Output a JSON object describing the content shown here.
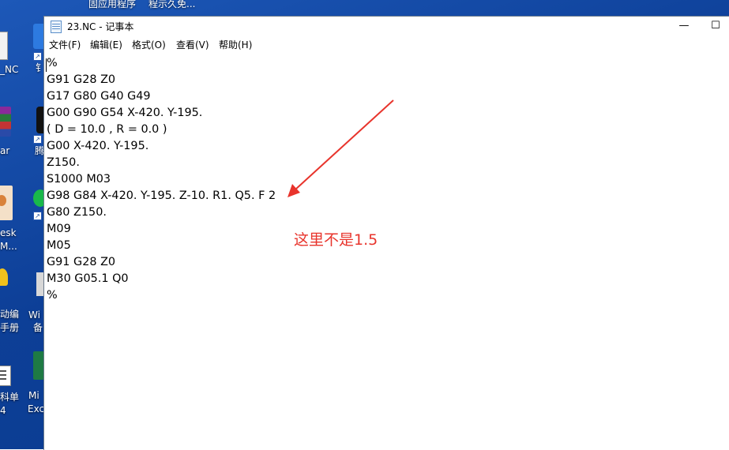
{
  "desktop": {
    "top_labels": [
      "固应用程序",
      "程示久免..."
    ],
    "icons": [
      {
        "label": "_NC"
      },
      {
        "label": "ar"
      },
      {
        "label": "esk"
      },
      {
        "label": "M..."
      },
      {
        "label": "动编"
      },
      {
        "label": "手册"
      },
      {
        "label": "科单"
      },
      {
        "label": "4"
      }
    ],
    "partial_labels": [
      "钅",
      "腾",
      "Wi",
      "备",
      "Mi",
      "Exc"
    ]
  },
  "window": {
    "title": "23.NC - 记事本",
    "minimize_glyph": "—",
    "maximize_glyph": "☐"
  },
  "menu": {
    "file": "文件(F)",
    "edit": "编辑(E)",
    "format": "格式(O)",
    "view": "查看(V)",
    "help": "帮助(H)"
  },
  "editor": {
    "lines": [
      "%",
      "G91 G28 Z0",
      "G17 G80 G40 G49",
      "G00 G90 G54 X-420. Y-195.",
      "( D = 10.0 , R = 0.0 )",
      "G00 X-420. Y-195.",
      "Z150.",
      "S1000 M03",
      "G98 G84 X-420. Y-195. Z-10. R1. Q5. F 2",
      "G80 Z150.",
      "M09",
      "M05",
      "G91 G28 Z0",
      "M30 G05.1 Q0",
      "%"
    ]
  },
  "annotation": {
    "text": "这里不是1.5",
    "color": "#e8342c"
  }
}
